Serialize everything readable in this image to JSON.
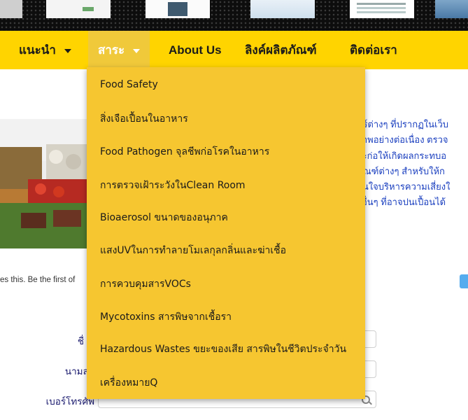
{
  "nav": {
    "items": [
      {
        "label": "แนะนำ",
        "has_caret": true
      },
      {
        "label": "สาระ",
        "has_caret": true,
        "active": true
      },
      {
        "label": "About Us"
      },
      {
        "label": "ลิงค์ผลิตภัณฑ์"
      },
      {
        "label": "ติดต่อเรา"
      }
    ],
    "bar_color": "#ffd400",
    "active_color": "#f0c93a"
  },
  "dropdown": {
    "items": [
      "Food Safety",
      "สิ่งเจือเปื้อนในอาหาร",
      "Food Pathogen จุลชีพก่อโรคในอาหาร",
      "การตรวจเฝ้าระวังในClean Room",
      "Bioaerosol ขนาดของอนุภาค",
      "แสงUVในการทำลายโมเลกุลกลิ่นและฆ่าเชื้อ",
      "การควบคุมสารVOCs",
      "Mycotoxins สารพิษจากเชื้อรา",
      "Hazardous Wastes ขยะของเสีย สารพิษในชีวิตประจำวัน",
      "เครื่องหมายQ"
    ],
    "bg_color": "#f6c630"
  },
  "content": {
    "text_lines": [
      "ตร์ต่างๆ ที่ปรากฏในเว็บ",
      "กาพอย่างต่อเนื่อง ตรวจ",
      "จะก่อให้เกิดผลกระทบอ",
      "ภัณฑ์ต่างๆ สำหรับให้ก",
      "สินใจบริหารความเสี่ยงใ",
      "ะอื่นๆ ที่อาจปนเปื้อนได้"
    ],
    "likes_text": "es this. Be the first of",
    "form": {
      "labels": [
        "ชื่",
        "นามสกุ",
        "เบอร์โทรศัพ"
      ]
    },
    "icons": [
      "twitter-icon",
      "search-icon"
    ]
  }
}
